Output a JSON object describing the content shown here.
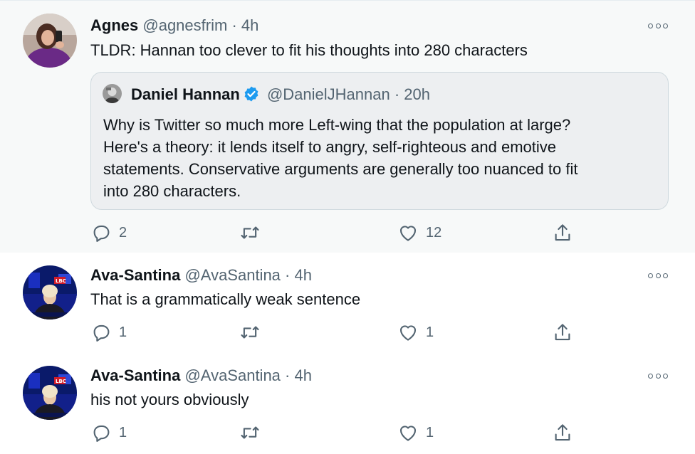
{
  "tweets": [
    {
      "name": "Agnes",
      "handle": "@agnesfrim",
      "separator": "·",
      "time": "4h",
      "text": "TLDR: Hannan too clever to fit his thoughts into 280 characters",
      "quote": {
        "name": "Daniel Hannan",
        "handle": "@DanielJHannan",
        "separator": "·",
        "time": "20h",
        "lines": [
          "Why is Twitter so much more Left-wing that the population at large?",
          "Here's a theory: it lends itself to angry, self-righteous and emotive",
          "statements. Conservative arguments are generally too nuanced to fit",
          "into 280 characters."
        ]
      },
      "replies": "2",
      "retweets": "",
      "likes": "12"
    },
    {
      "name": "Ava-Santina",
      "handle": "@AvaSantina",
      "separator": "·",
      "time": "4h",
      "text": "That is a grammatically weak sentence",
      "replies": "1",
      "retweets": "",
      "likes": "1"
    },
    {
      "name": "Ava-Santina",
      "handle": "@AvaSantina",
      "separator": "·",
      "time": "4h",
      "text": "his not yours obviously",
      "replies": "1",
      "retweets": "",
      "likes": "1"
    }
  ],
  "icons": {
    "reply": "reply-icon",
    "retweet": "retweet-icon",
    "like": "heart-icon",
    "share": "share-icon",
    "more": "more-options-icon",
    "verified": "verified-badge-icon"
  },
  "colors": {
    "text": "#0f1419",
    "secondary": "#536471",
    "verified": "#1d9bf0",
    "thread_line": "#c4cfd6",
    "highlight_bg": "#f7f9f9"
  }
}
